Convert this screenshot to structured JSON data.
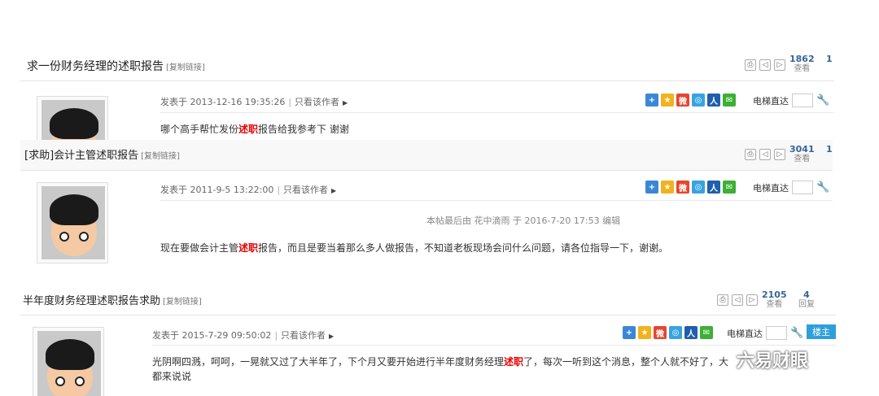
{
  "posts": [
    {
      "title": "求一份财务经理的述职报告",
      "copy_link": "[复制链接]",
      "views": "1862",
      "views_label": "查看",
      "replies_partial": "1",
      "meta_posted": "发表于 2013-12-16 19:35:26",
      "meta_author_only": "只看该作者",
      "elevator": "电梯直达",
      "body_before": "哪个高手帮忙发份",
      "body_highlight": "述职",
      "body_after": "报告给我参考下 谢谢"
    },
    {
      "title": "[求助]会计主管述职报告",
      "copy_link": "[复制链接]",
      "views": "3041",
      "views_label": "查看",
      "replies_partial": "1",
      "meta_posted": "发表于 2011-9-5 13:22:00",
      "meta_author_only": "只看该作者",
      "elevator": "电梯直达",
      "edited_note": "本帖最后由 花中滴雨 于 2016-7-20 17:53 编辑",
      "body_before": "现在要做会计主管",
      "body_highlight": "述职",
      "body_after": "报告，而且是要当着那么多人做报告，不知道老板现场会问什么问题，请各位指导一下，谢谢。"
    },
    {
      "title": "半年度财务经理述职报告求助",
      "copy_link": "[复制链接]",
      "views": "2105",
      "views_label": "查看",
      "replies": "4",
      "replies_label": "回复",
      "meta_posted": "发表于 2015-7-29 09:50:02",
      "meta_author_only": "只看该作者",
      "elevator": "电梯直达",
      "owner_label": "楼主",
      "body_before": "光阴啊四溅，呵呵，一晃就又过了大半年了，下个月又要开始进行半年度财务经理",
      "body_highlight": "述职",
      "body_after": "了，每次一听到这个消息，整个人就不好了，大",
      "body_line2": "都来说说"
    }
  ],
  "share_icons": [
    "plus-icon",
    "qzone-icon",
    "weibo-icon",
    "tencent-icon",
    "renren-icon",
    "wechat-icon"
  ],
  "watermark": "六易财眼",
  "colors": {
    "accent": "#2e9fdc",
    "highlight": "#ee0000",
    "stat": "#336699"
  }
}
